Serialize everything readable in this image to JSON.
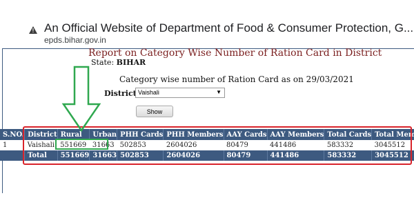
{
  "browser": {
    "site_title": "An Official Website of Department of Food & Consumer Protection, G...",
    "site_url": "epds.bihar.gov.in"
  },
  "report": {
    "title": "Report on Category Wise Number of Ration Card in District",
    "state_label": "State:",
    "state_value": "BIHAR",
    "as_of_text": "Category wise number of Ration Card as on 29/03/2021",
    "district_label": "District :",
    "district_selected": "Vaishali",
    "show_button": "Show"
  },
  "table": {
    "headers": [
      "S.NO.",
      "District",
      "Rural",
      "Urban",
      "PHH Cards",
      "PHH Members",
      "AAY Cards",
      "AAY Members",
      "Total Cards",
      "Total Members"
    ],
    "rows": [
      [
        "1",
        "Vaishali",
        "551669",
        "31663",
        "502853",
        "2604026",
        "80479",
        "441486",
        "583332",
        "3045512"
      ]
    ],
    "total_row": [
      "",
      "Total",
      "551669",
      "31663",
      "502853",
      "2604026",
      "80479",
      "441486",
      "583332",
      "3045512"
    ]
  },
  "colors": {
    "header_bg": "#3d5a80",
    "title_color": "#7a1e1e",
    "annotation_red": "#d8232a",
    "annotation_green": "#2fa84f"
  }
}
